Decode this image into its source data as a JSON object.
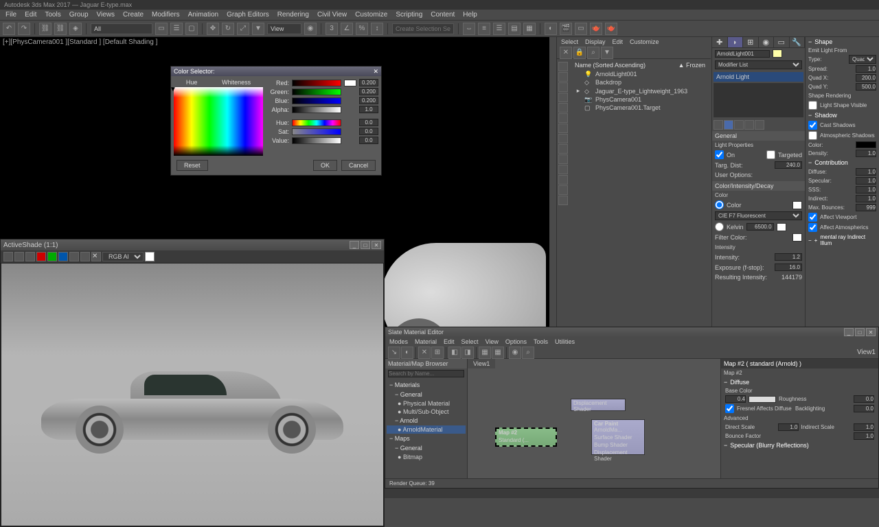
{
  "app": {
    "title": "Autodesk 3ds Max 2017 — Jaguar E-type.max"
  },
  "menu": [
    "File",
    "Edit",
    "Tools",
    "Group",
    "Views",
    "Create",
    "Modifiers",
    "Animation",
    "Graph Editors",
    "Rendering",
    "Civil View",
    "Customize",
    "Scripting",
    "Content",
    "Help"
  ],
  "toolbar": {
    "selection_set": "All",
    "create_set": "Create Selection Set"
  },
  "viewport": {
    "label": "[+][PhysCamera001 ][Standard ] [Default Shading ]"
  },
  "activeshade": {
    "title": "ActiveShade  (1:1)",
    "channel": "RGB Alpha"
  },
  "color_selector": {
    "title": "Color Selector:",
    "hue_label": "Hue",
    "white_label": "Whiteness",
    "rows": [
      {
        "label": "Red:",
        "val": "0.200"
      },
      {
        "label": "Green:",
        "val": "0.200"
      },
      {
        "label": "Blue:",
        "val": "0.200"
      },
      {
        "label": "Alpha:",
        "val": "1.0"
      },
      {
        "label": "Hue:",
        "val": "0.0"
      },
      {
        "label": "Sat:",
        "val": "0.0"
      },
      {
        "label": "Value:",
        "val": "0.0"
      }
    ],
    "reset": "Reset",
    "ok": "OK",
    "cancel": "Cancel"
  },
  "scene_explorer": {
    "tabs": [
      "Select",
      "Display",
      "Edit",
      "Customize"
    ],
    "header_name": "Name (Sorted Ascending)",
    "header_frozen": "▲ Frozen",
    "items": [
      {
        "exp": "",
        "name": "ArnoldLight001"
      },
      {
        "exp": "",
        "name": "Backdrop"
      },
      {
        "exp": "▸",
        "name": "Jaguar_E-type_Lightweight_1963"
      },
      {
        "exp": "",
        "name": "PhysCamera001"
      },
      {
        "exp": "",
        "name": "PhysCamera001.Target"
      }
    ]
  },
  "command_panel": {
    "name_label": "ArnoldLight001",
    "modifier_list": "Modifier List",
    "stack_item": "Arnold Light",
    "general": "General",
    "light_props": "Light Properties",
    "on": "On",
    "targeted": "Targeted",
    "targ_dist": "Targ. Dist:",
    "targ_dist_val": "240.0",
    "user_options": "User Options:",
    "cid": "Color/Intensity/Decay",
    "color": "Color",
    "color_type": "Color",
    "preset": "CIE F7 Fluorescent",
    "kelvin": "Kelvin",
    "kelvin_val": "6500.0",
    "filter_color": "Filter Color:",
    "intensity_h": "Intensity",
    "intensity": "Intensity:",
    "intensity_val": "1.2",
    "exposure": "Exposure (f-stop):",
    "exposure_val": "16.0",
    "res_intensity": "Resulting Intensity:",
    "res_val": "144179"
  },
  "attrib": {
    "shape": "Shape",
    "emit": "Emit Light From",
    "type": "Type:",
    "type_val": "Quad",
    "spread": "Spread:",
    "spread_val": "1.0",
    "quadx": "Quad X:",
    "quadx_val": "200.0",
    "quady": "Quad Y:",
    "quady_val": "500.0",
    "shape_render": "Shape Rendering",
    "light_shape_vis": "Light Shape Visible",
    "shadow": "Shadow",
    "cast_shadows": "Cast Shadows",
    "atmos_shadows": "Atmospheric Shadows",
    "color_l": "Color:",
    "density": "Density:",
    "density_val": "1.0",
    "contribution": "Contribution",
    "diffuse": "Diffuse:",
    "specular": "Specular:",
    "sss": "SSS:",
    "indirect": "Indirect:",
    "one": "1.0",
    "max_bounces": "Max. Bounces:",
    "max_bounces_val": "999",
    "affect_vp": "Affect Viewport",
    "affect_atmos": "Affect Atmospherics",
    "mental": "mental ray Indirect Illum"
  },
  "slate": {
    "title": "Slate Material Editor",
    "menu": [
      "Modes",
      "Material",
      "Edit",
      "Select",
      "View",
      "Options",
      "Tools",
      "Utilities"
    ],
    "browser": "Material/Map Browser",
    "search": "Search by Name...",
    "materials": "Materials",
    "general": "General",
    "phys_mat": "Physical Material",
    "multi_sub": "Multi/Sub-Object",
    "arnold": "Arnold",
    "arnold_mat": "ArnoldMaterial",
    "maps": "Maps",
    "general2": "General",
    "bitmap": "Bitmap",
    "view_tab": "View1",
    "node_disp": "Displacement Shader",
    "node_map": "Map #2",
    "node_map_sub": "Standard (...",
    "node_carpaint": "Car Paint",
    "node_carpaint_sub": "ArnoldMa...",
    "node_surface": "Surface Shader",
    "node_bump": "Bump Shader",
    "node_disp2": "Displacement Shader",
    "param_title": "Map #2  ( standard (Arnold) )",
    "param_name": "Map #2",
    "diffuse_h": "Diffuse",
    "base_color": "Base Color",
    "base_val": "0.4",
    "roughness": "Roughness",
    "roughness_val": "0.0",
    "fresnel": "Fresnel Affects Diffuse",
    "backlight": "Backlighting",
    "backlight_val": "0.0",
    "advanced": "Advanced",
    "direct_scale": "Direct Scale",
    "indirect_scale": "Indirect Scale",
    "scale_val": "1.0",
    "bounce_factor": "Bounce Factor",
    "spec_h": "Specular (Blurry Reflections)",
    "status": "Render Queue: 39"
  }
}
